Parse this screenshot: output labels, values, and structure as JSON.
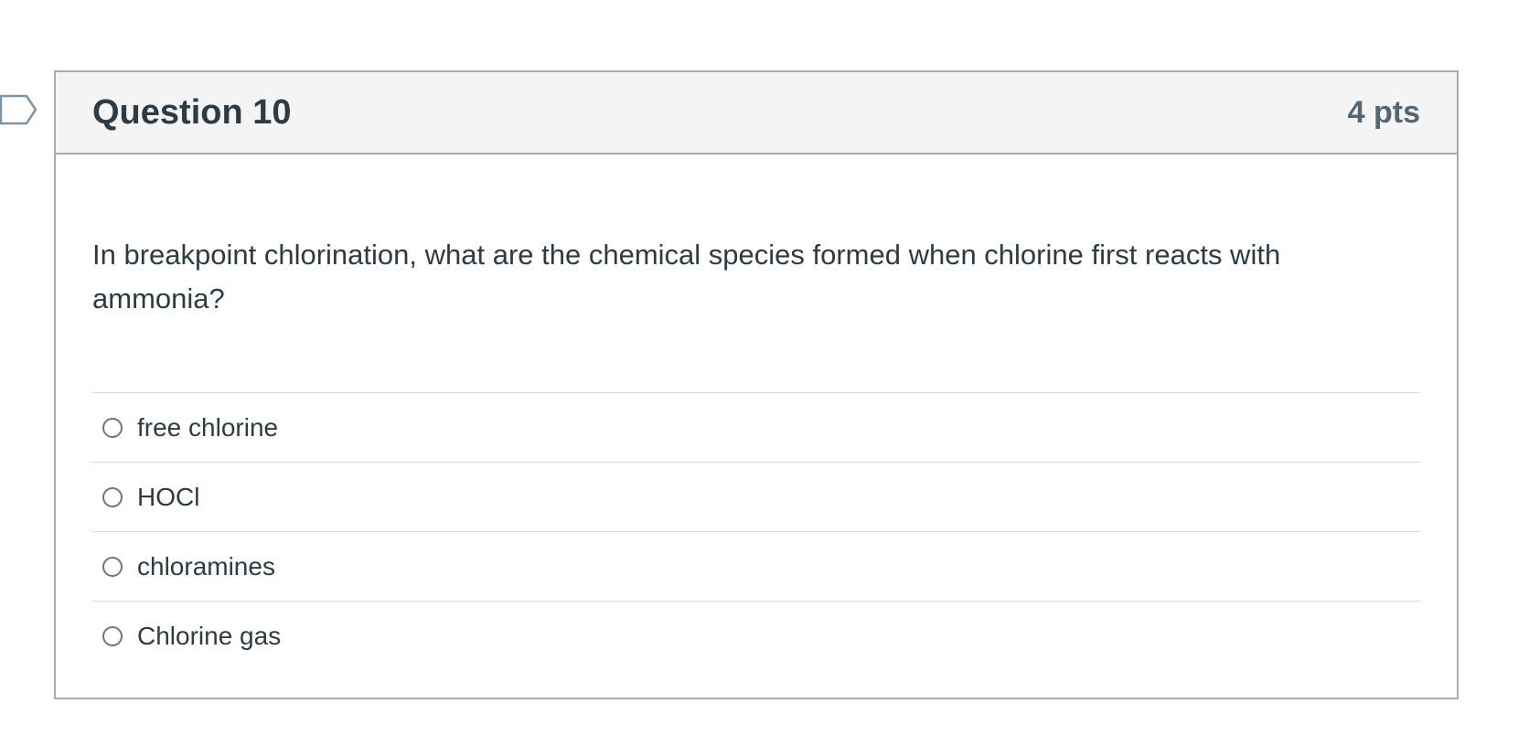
{
  "question": {
    "title": "Question 10",
    "points": "4 pts",
    "text": "In breakpoint chlorination, what are the chemical species formed when chlorine first reacts with ammonia?",
    "answers": [
      {
        "label": "free chlorine"
      },
      {
        "label": "HOCl"
      },
      {
        "label": "chloramines"
      },
      {
        "label": "Chlorine gas"
      }
    ]
  },
  "colors": {
    "header_bg": "#f4f4f4",
    "border": "#a5adb3",
    "text": "#2d3b45",
    "points_text": "#556572",
    "flag_stroke": "#7a95a8"
  },
  "icons": {
    "flag": "flag-question-icon",
    "radio": "radio-unselected-icon"
  }
}
